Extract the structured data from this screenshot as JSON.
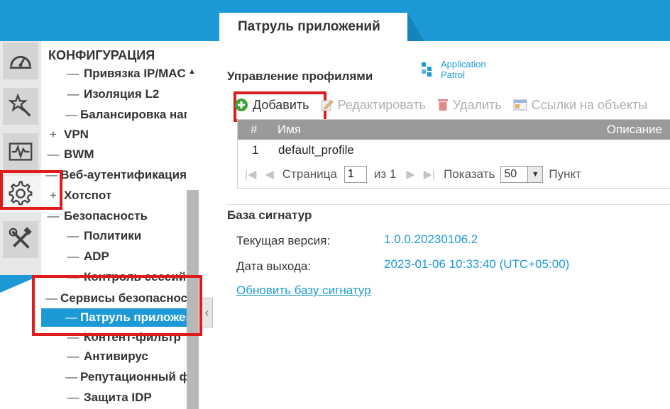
{
  "header": {
    "active_tab": "Патруль приложений"
  },
  "rail": {
    "items": [
      {
        "icon": "dashboard-gauge-icon"
      },
      {
        "icon": "wizard-wand-icon"
      },
      {
        "icon": "monitor-pulse-icon"
      },
      {
        "icon": "gear-icon",
        "active": true
      },
      {
        "icon": "maintenance-tools-icon"
      }
    ]
  },
  "tree": {
    "header": "КОНФИГУРАЦИЯ",
    "items": [
      {
        "label": "Привязка IP/MAC",
        "bullet": "—"
      },
      {
        "label": "Изоляция L2",
        "bullet": "—"
      },
      {
        "label": "Балансировка нагрузки",
        "bullet": "—"
      },
      {
        "label": "VPN",
        "bullet": "+"
      },
      {
        "label": "BWM",
        "bullet": "—"
      },
      {
        "label": "Веб-аутентификация",
        "bullet": "—"
      },
      {
        "label": "Хотспот",
        "bullet": "+"
      },
      {
        "label": "Безопасность",
        "bullet": "—"
      },
      {
        "label": "Политики",
        "bullet": "—"
      },
      {
        "label": "ADP",
        "bullet": "—"
      },
      {
        "label": "Контроль сессий",
        "bullet": "—"
      },
      {
        "label": "Сервисы безопасности",
        "bullet": "—"
      },
      {
        "label": "Патруль приложений",
        "bullet": "—"
      },
      {
        "label": "Контент-фильтр",
        "bullet": "—"
      },
      {
        "label": "Антивирус",
        "bullet": "—"
      },
      {
        "label": "Репутационный фильтр",
        "bullet": "—"
      },
      {
        "label": "Защита IDP",
        "bullet": "—"
      }
    ]
  },
  "profiles": {
    "title": "Управление профилями",
    "logo_line1": "Application",
    "logo_line2": "Patrol",
    "toolbar": {
      "add": "Добавить",
      "edit": "Редактировать",
      "delete": "Удалить",
      "references": "Ссылки на объекты"
    },
    "columns": {
      "num": "#",
      "name": "Имя",
      "description": "Описание"
    },
    "rows": [
      {
        "num": "1",
        "name": "default_profile",
        "description": ""
      }
    ],
    "pager": {
      "page_label": "Страница",
      "page_value": "1",
      "of_label": "из 1",
      "show_label": "Показать",
      "per_page": "50",
      "items_label": "Пункт"
    }
  },
  "signatures": {
    "title": "База сигнатур",
    "current_version_label": "Текущая версия:",
    "current_version": "1.0.0.20230106.2",
    "release_date_label": "Дата выхода:",
    "release_date": "2023-01-06 10:33:40 (UTC+05:00)",
    "update_link": "Обновить базу сигнатур"
  },
  "colors": {
    "accent": "#1d9ad6",
    "highlight_box": "#e01b1b",
    "add_icon": "#3aa335",
    "delete_icon": "#d9534f"
  }
}
